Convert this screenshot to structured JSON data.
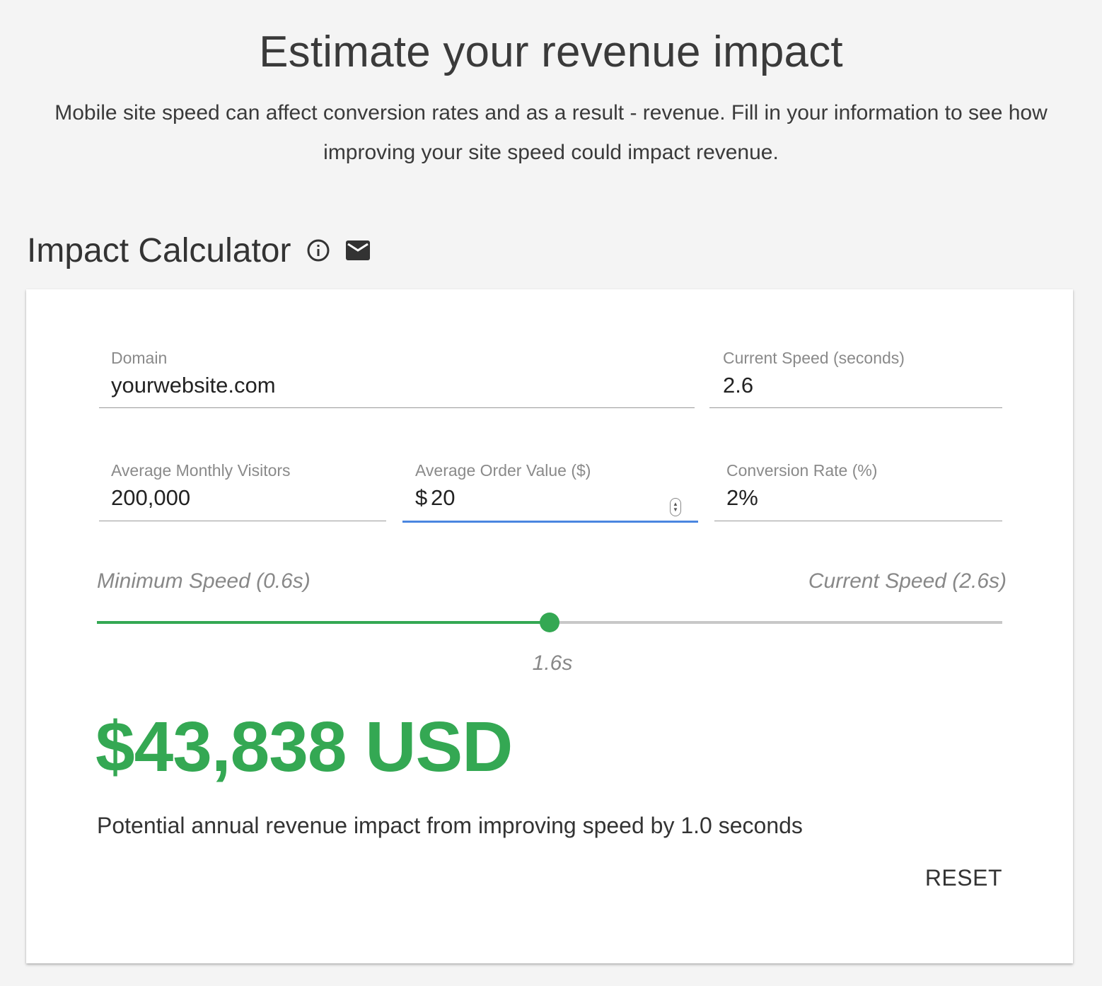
{
  "header": {
    "title": "Estimate your revenue impact",
    "subtitle": "Mobile site speed can affect conversion rates and as a result - revenue. Fill in your information to see how improving your site speed could impact revenue."
  },
  "calculator": {
    "title": "Impact Calculator",
    "icons": [
      "info-icon",
      "email-icon"
    ],
    "fields": {
      "domain": {
        "label": "Domain",
        "value": "yourwebsite.com"
      },
      "current_speed": {
        "label": "Current Speed (seconds)",
        "value": "2.6"
      },
      "monthly_visitors": {
        "label": "Average Monthly Visitors",
        "value": "200,000"
      },
      "order_value": {
        "label": "Average Order Value ($)",
        "currency": "$",
        "value": "20"
      },
      "conversion_rate": {
        "label": "Conversion Rate (%)",
        "value": "2%"
      }
    },
    "slider": {
      "min_label": "Minimum Speed (0.6s)",
      "max_label": "Current Speed (2.6s)",
      "min": 0.6,
      "max": 2.6,
      "value": 1.6,
      "value_label": "1.6s"
    },
    "result": {
      "amount": "$43,838 USD",
      "description": "Potential annual revenue impact from improving speed by 1.0 seconds"
    },
    "reset_label": "RESET"
  },
  "colors": {
    "accent_green": "#34a853",
    "focus_blue": "#4a86e0"
  }
}
